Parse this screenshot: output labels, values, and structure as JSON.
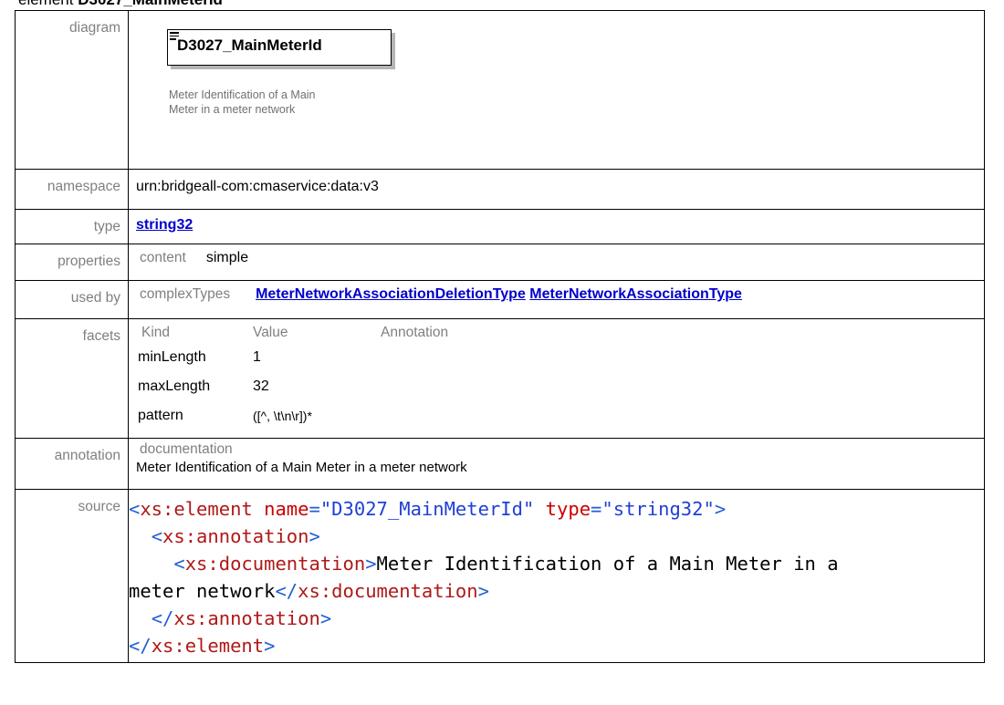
{
  "heading": {
    "prefix": "element",
    "name": "D3027_MainMeterId"
  },
  "labels": {
    "diagram": "diagram",
    "namespace": "namespace",
    "type": "type",
    "properties": "properties",
    "used_by": "used by",
    "facets": "facets",
    "annotation": "annotation",
    "source": "source"
  },
  "diagram": {
    "element_name": "D3027_MainMeterId",
    "documentation": "Meter Identification of a Main Meter in a meter network"
  },
  "namespace": "urn:bridgeall-com:cmaservice:data:v3",
  "type": "string32",
  "properties": {
    "key": "content",
    "value": "simple"
  },
  "used_by": {
    "key": "complexTypes",
    "links": [
      "MeterNetworkAssociationDeletionType",
      "MeterNetworkAssociationType"
    ]
  },
  "facets": {
    "headers": [
      "Kind",
      "Value",
      "Annotation"
    ],
    "rows": [
      {
        "kind": "minLength",
        "value": "1"
      },
      {
        "kind": "maxLength",
        "value": "32"
      },
      {
        "kind": "pattern",
        "value": "([^, \\t\\n\\r])*"
      }
    ]
  },
  "annotation": {
    "key": "documentation",
    "text": "Meter Identification of a Main Meter in a meter network"
  },
  "source": {
    "open_tag": "xs:element",
    "attr_name_1": "name",
    "attr_value_1": "\"D3027_MainMeterId\"",
    "attr_name_2": "type",
    "attr_value_2": "\"string32\"",
    "annotation_tag": "xs:annotation",
    "documentation_tag": "xs:documentation",
    "doc_text_1": "Meter Identification of a Main Meter in a",
    "doc_text_2": "meter network"
  },
  "colors": {
    "link": "#0000cc",
    "label": "#808080",
    "xml_tag": "#b01818",
    "xml_bracket": "#1f5fd6"
  }
}
